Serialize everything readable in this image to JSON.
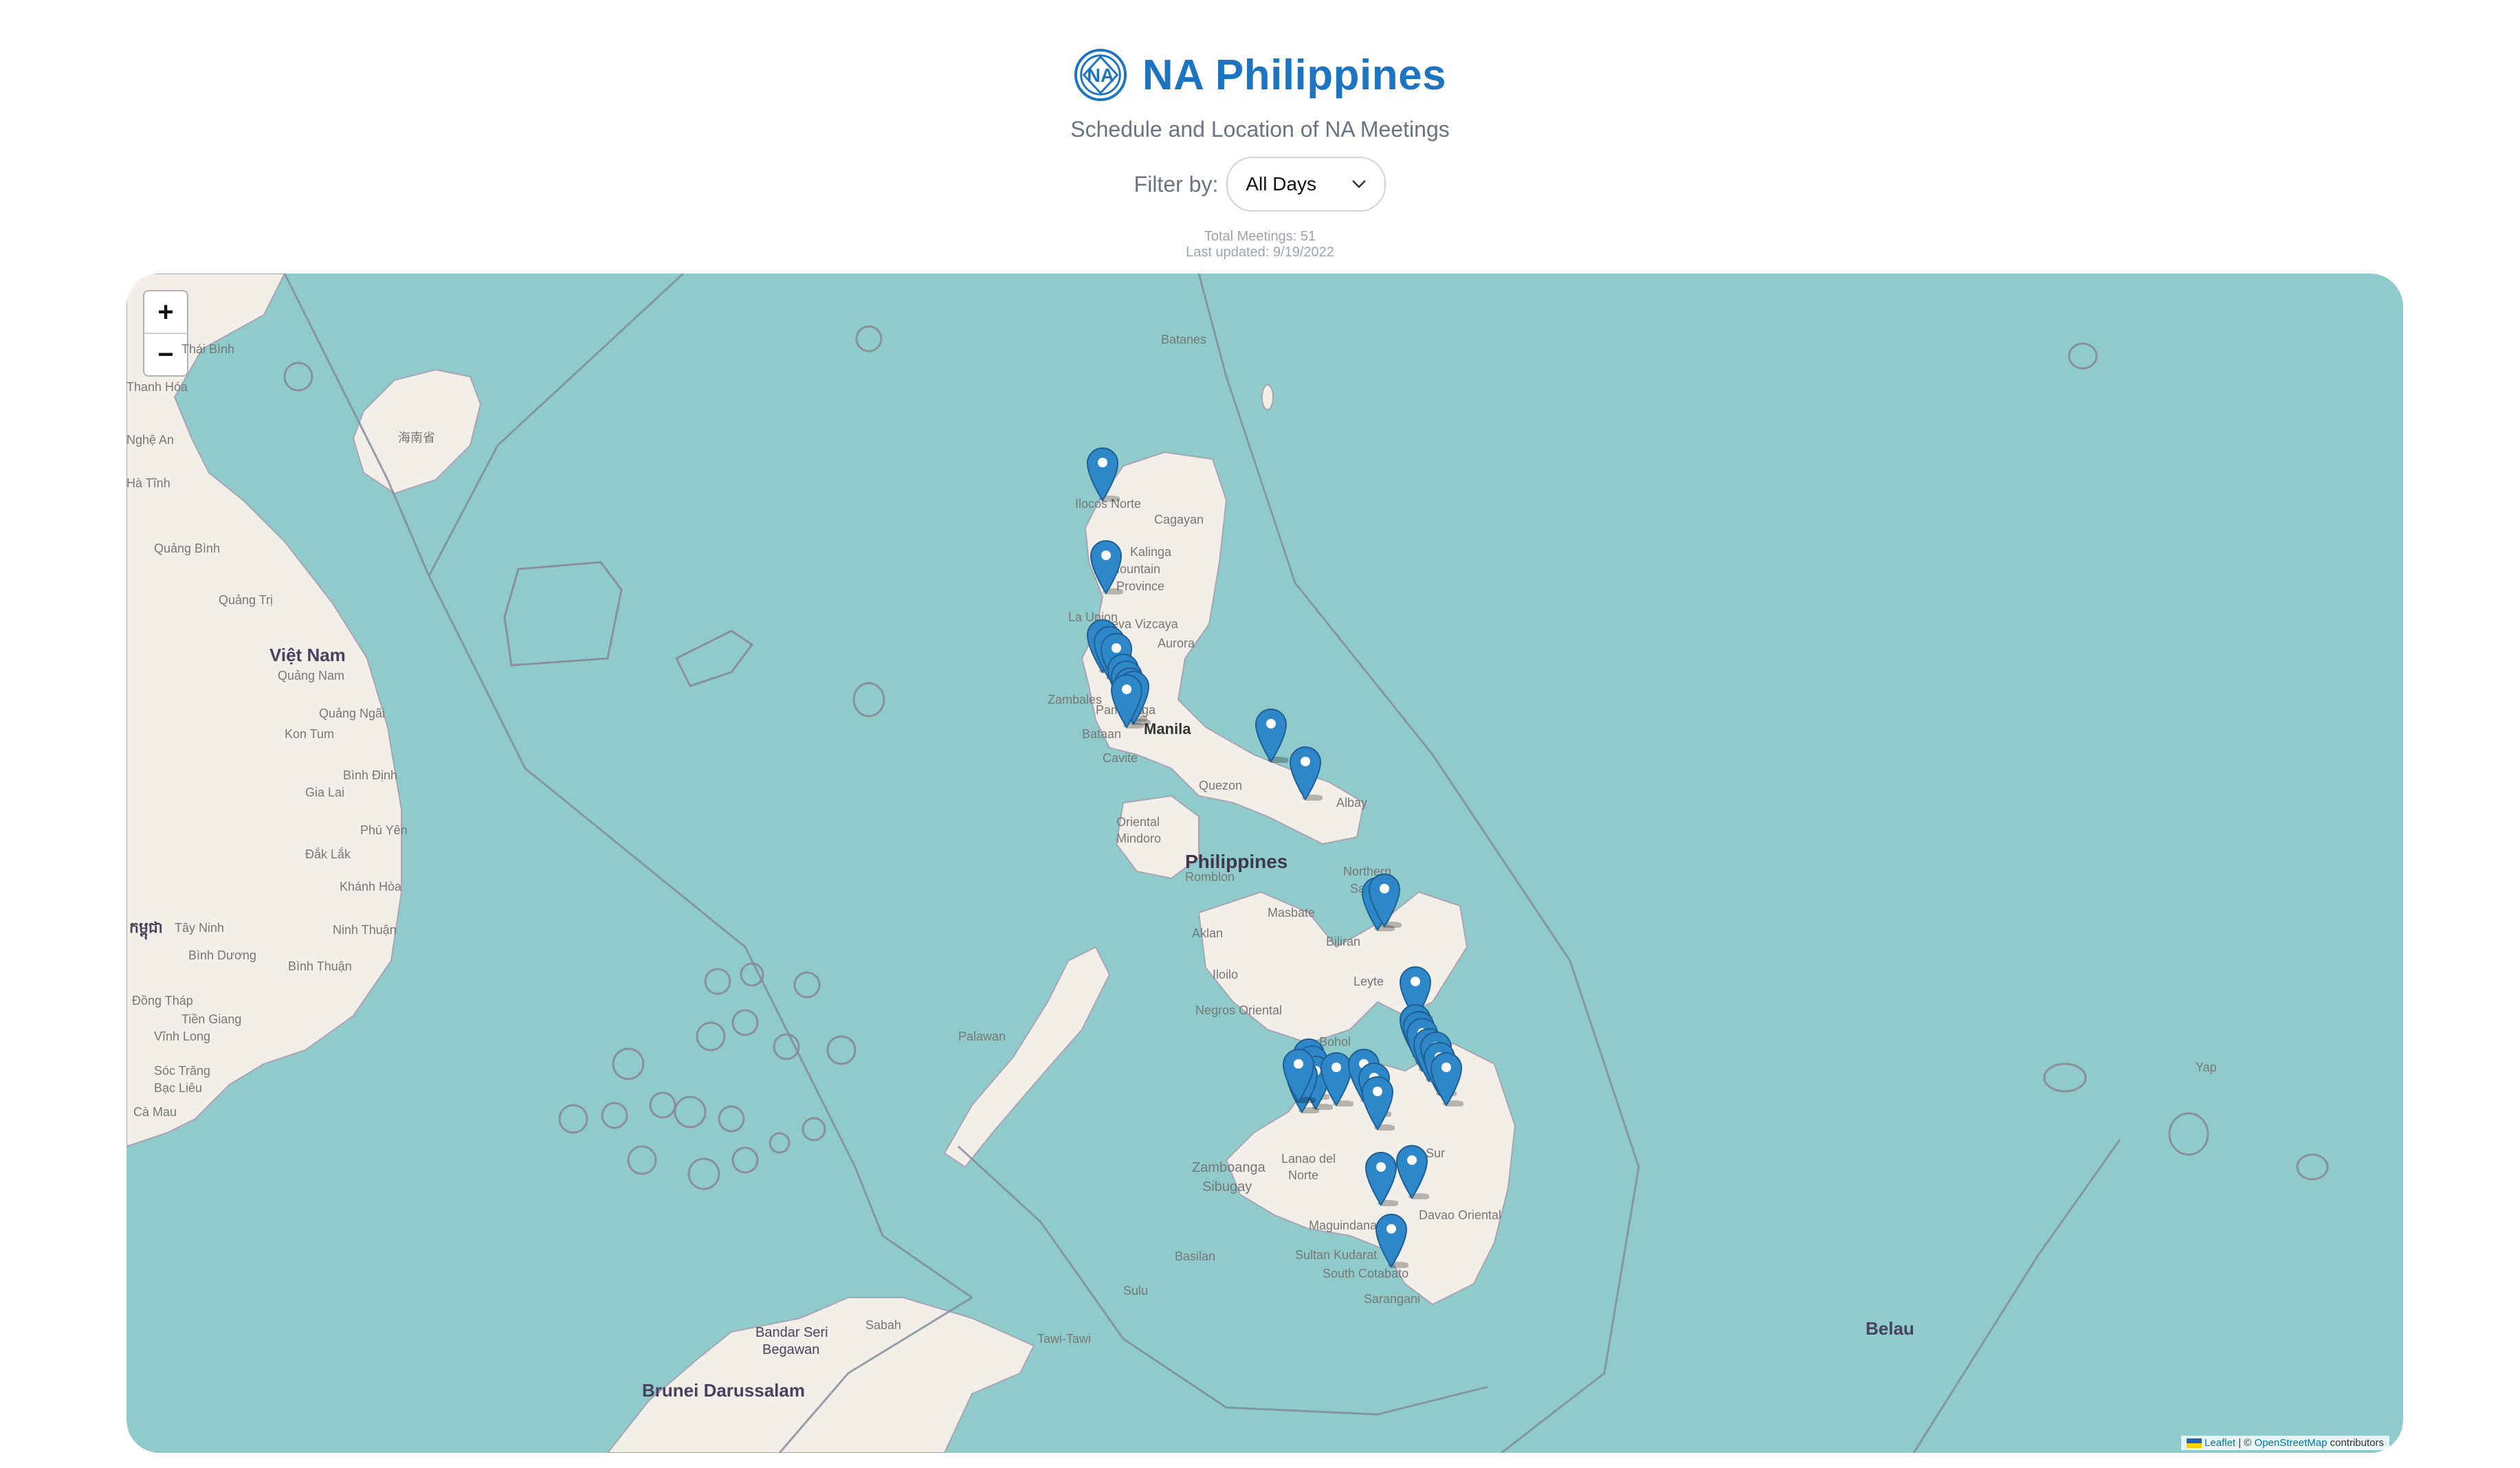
{
  "header": {
    "title": "NA Philippines",
    "subtitle": "Schedule and Location of NA Meetings",
    "filter_label": "Filter by:",
    "filter_value": "All Days",
    "total_meetings": "Total Meetings: 51",
    "last_updated": "Last updated: 9/19/2022"
  },
  "map": {
    "zoom_in": "+",
    "zoom_out": "−",
    "attribution_leaflet": "Leaflet",
    "attribution_sep": " | © ",
    "attribution_osm": "OpenStreetMap",
    "attribution_tail": " contributors",
    "labels": {
      "vietnam": "Việt Nam",
      "philippines": "Philippines",
      "manila": "Manila",
      "belau": "Belau",
      "brunei": "Brunei Darussalam",
      "bandar": "Bandar Seri",
      "begawan": "Begawan",
      "batanes": "Batanes",
      "ilocos": "Ilocos Norte",
      "cagayan": "Cagayan",
      "kalinga": "Kalinga",
      "mountain": "Mountain",
      "province": "Province",
      "nueva": "Nueva Vizcaya",
      "aurora": "Aurora",
      "launion": "La Union",
      "zambales": "Zambales",
      "pampanga": "Pampanga",
      "bataan": "Bataan",
      "cavite": "Cavite",
      "quezon": "Quezon",
      "oriental": "Oriental",
      "mindoro": "Mindoro",
      "romblon": "Romblon",
      "masbate": "Masbate",
      "northern": "Northern",
      "samar": "Samar",
      "biliran": "Biliran",
      "leyte": "Leyte",
      "aklan": "Aklan",
      "iloilo": "Iloilo",
      "negros": "Negros Oriental",
      "bohol": "Bohol",
      "palawan": "Palawan",
      "zamboanga": "Zamboanga",
      "sibugay": "Sibugay",
      "lanao": "Lanao del",
      "norte": "Norte",
      "davao": "Davao Oriental",
      "maguindanao": "Maguindanao",
      "sultan": "Sultan Kudarat",
      "southcot": "South Cotabato",
      "sarangani": "Sarangani",
      "basilan": "Basilan",
      "sulu": "Sulu",
      "tawitawi": "Tawi-Tawi",
      "sabah": "Sabah",
      "albay": "Albay",
      "sur": "Sur",
      "yap": "Yap",
      "quangtri": "Quảng Trị",
      "quangnam": "Quảng Nam",
      "quangngai": "Quảng Ngãi",
      "kontum": "Kon Tum",
      "gialai": "Gia Lai",
      "binhdinh": "Bình Định",
      "phuyen": "Phú Yên",
      "daklak": "Đắk Lắk",
      "khanhhoa": "Khánh Hòa",
      "ninhthuan": "Ninh Thuận",
      "binhthuan": "Bình Thuận",
      "binhduong": "Bình Dương",
      "tayninh": "Tây Ninh",
      "dongthap": "Đồng Tháp",
      "tiengiang": "Tiền Giang",
      "vinhlong": "Vĩnh Long",
      "soctrang": "Sóc Trăng",
      "baclieu": "Bạc Liêu",
      "camau": "Cà Mau",
      "cambodia": "កម្ពុជា",
      "thaibinh": "Thái Bình",
      "thanhhoa": "Thanh Hóa",
      "nghean": "Nghệ An",
      "hatinh": "Hà Tĩnh",
      "quangbinh": "Quảng Bình",
      "hainan": "海南省"
    }
  },
  "colors": {
    "accent": "#1d74c0",
    "water": "#8fcbcb",
    "land": "#f2efe9",
    "marker": "#2e87c8"
  }
}
